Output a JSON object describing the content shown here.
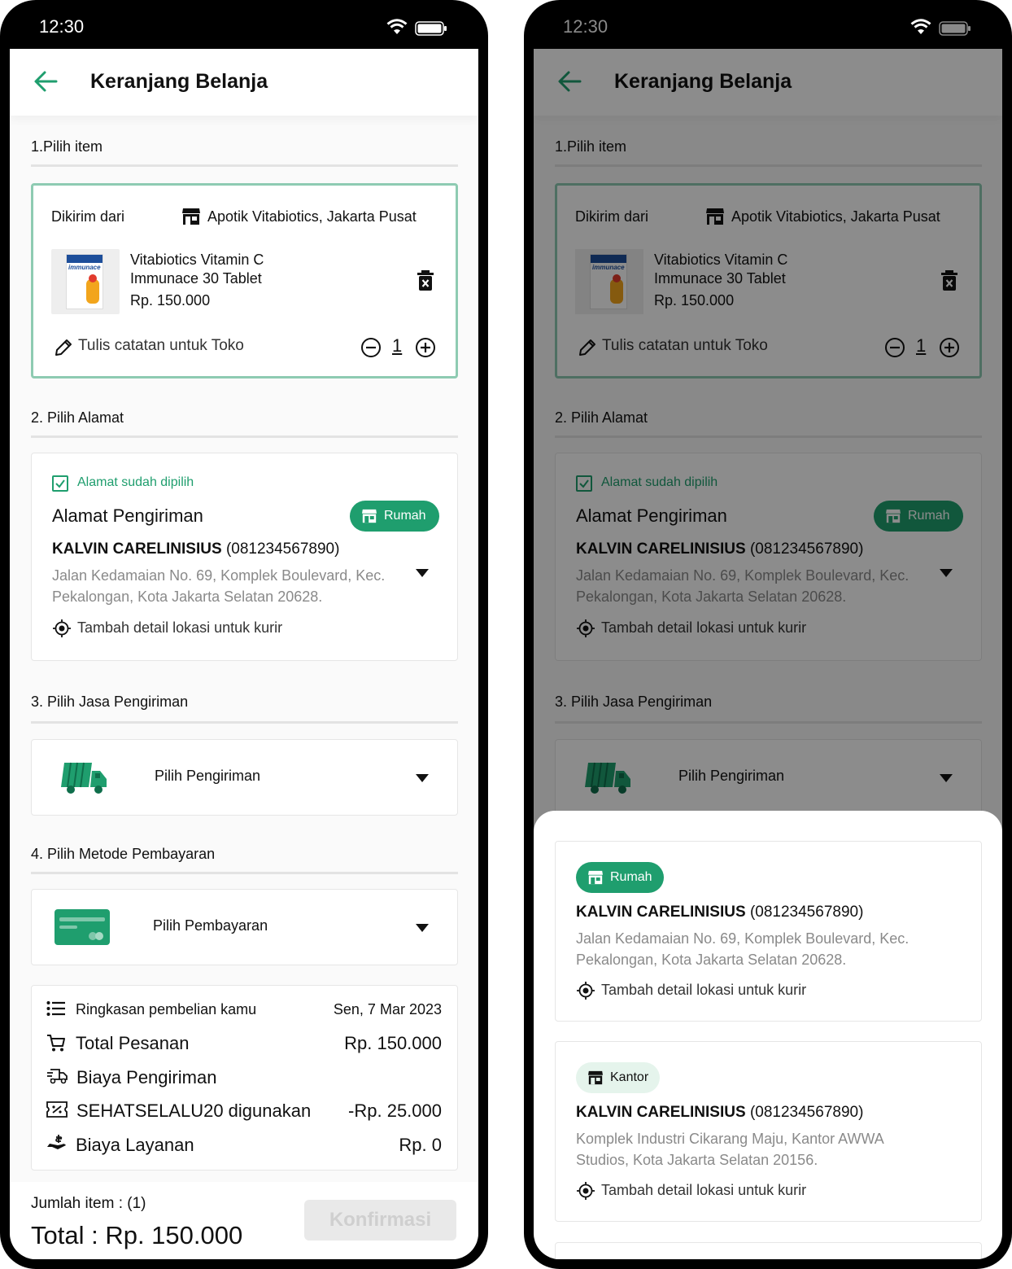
{
  "status_bar": {
    "time": "12:30"
  },
  "header": {
    "title": "Keranjang Belanja"
  },
  "section1": {
    "title": "1.Pilih item",
    "sent_from_label": "Dikirim dari",
    "store_name": "Apotik Vitabiotics, Jakarta Pusat",
    "product": {
      "name_line1": "Vitabiotics Vitamin C",
      "name_line2": "Immunace 30 Tablet",
      "price": "Rp. 150.000",
      "image_brand": "immunace"
    },
    "note_label": "Tulis catatan untuk Toko",
    "quantity": "1"
  },
  "section2": {
    "title": "2. Pilih Alamat",
    "selected_label": "Alamat sudah dipilih",
    "address_heading": "Alamat Pengiriman",
    "tag": "Rumah",
    "recipient_name": "KALVIN CARELINISIUS",
    "recipient_phone": "(081234567890)",
    "address_line1": "Jalan Kedamaian No. 69, Komplek Boulevard, Kec.",
    "address_line2": "Pekalongan, Kota Jakarta Selatan 20628.",
    "detail_label": "Tambah detail lokasi untuk kurir"
  },
  "section3": {
    "title": "3. Pilih Jasa Pengiriman",
    "select_label": "Pilih Pengiriman"
  },
  "section4": {
    "title": "4. Pilih Metode Pembayaran",
    "select_label": "Pilih Pembayaran"
  },
  "summary": {
    "title": "Ringkasan pembelian kamu",
    "date": "Sen, 7 Mar 2023",
    "total_label": "Total Pesanan",
    "total_value": "Rp. 150.000",
    "shipping_label": "Biaya Pengiriman",
    "voucher_label": "SEHATSELALU20 digunakan",
    "voucher_value": "-Rp. 25.000",
    "service_label": "Biaya Layanan",
    "service_value": "Rp. 0"
  },
  "footer": {
    "item_count": "Jumlah item : (1)",
    "total": "Total : Rp. 150.000",
    "confirm_label": "Konfirmasi"
  },
  "address_sheet": {
    "addresses": [
      {
        "tag": "Rumah",
        "name": "KALVIN CARELINISIUS",
        "phone": "(081234567890)",
        "line1": "Jalan Kedamaian No. 69, Komplek Boulevard, Kec.",
        "line2": "Pekalongan, Kota Jakarta Selatan 20628.",
        "detail_label": "Tambah detail lokasi untuk kurir"
      },
      {
        "tag": "Kantor",
        "name": "KALVIN CARELINISIUS",
        "phone": "(081234567890)",
        "line1": "Komplek Industri Cikarang Maju, Kantor AWWA",
        "line2": "Studios, Kota Jakarta Selatan 20156.",
        "detail_label": "Tambah detail lokasi untuk kurir"
      }
    ]
  },
  "colors": {
    "accent": "#1f9e6e",
    "accent_light": "#e5f4ec",
    "item_border": "#8ecbb2",
    "muted_text": "#8a8a8a"
  },
  "icons": [
    "arrow-left-icon",
    "store-icon",
    "trash-icon",
    "pencil-icon",
    "minus-circle-icon",
    "plus-circle-icon",
    "checkbox-checked-icon",
    "location-target-icon",
    "chevron-down-icon",
    "truck-icon",
    "card-icon",
    "list-icon",
    "cart-icon",
    "delivery-icon",
    "voucher-icon",
    "service-fee-icon",
    "wifi-icon",
    "battery-icon"
  ]
}
